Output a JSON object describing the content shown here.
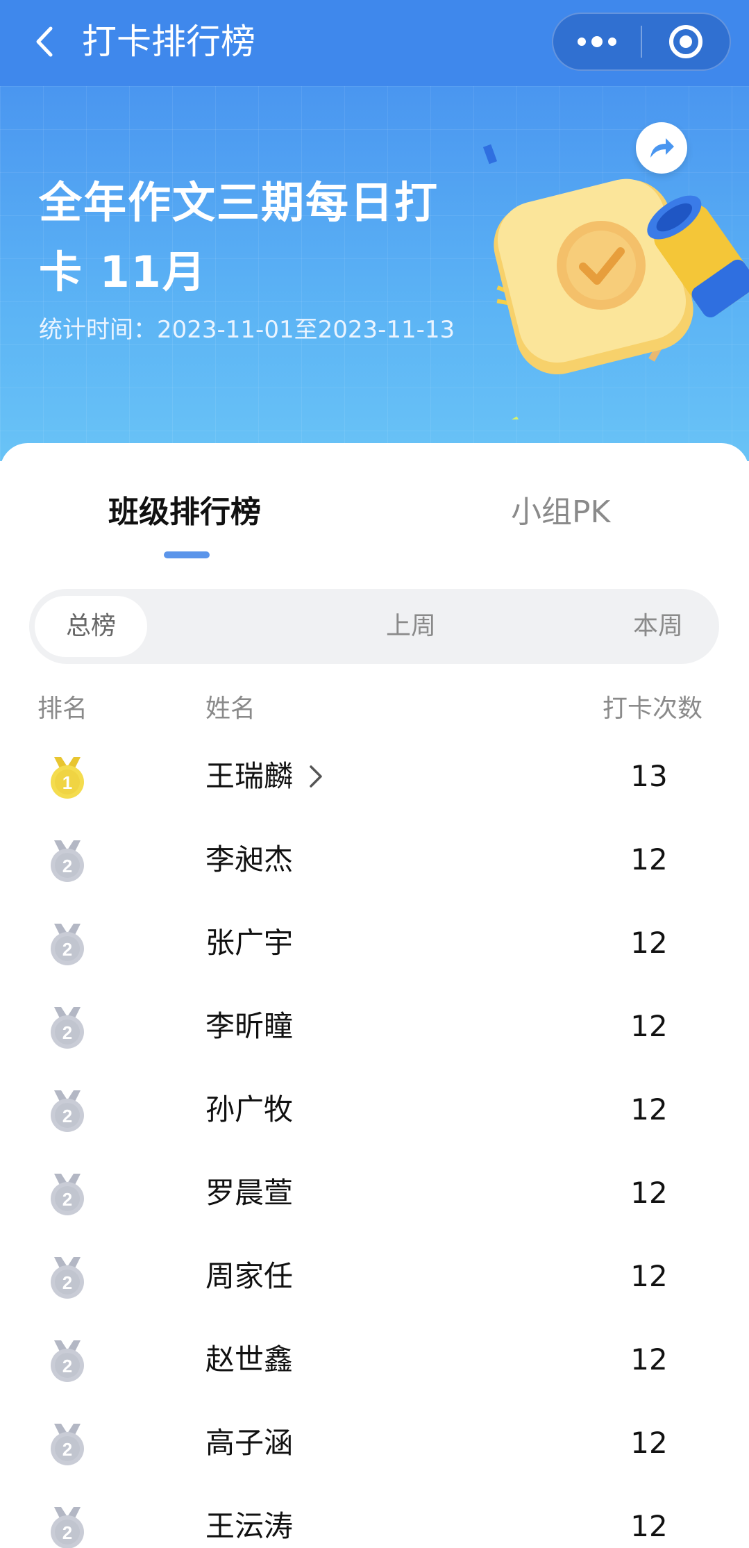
{
  "nav": {
    "title": "打卡排行榜"
  },
  "hero": {
    "title": "全年作文三期每日打卡 11月",
    "period": "统计时间：2023-11-01至2023-11-13"
  },
  "tabs": [
    {
      "label": "班级排行榜",
      "active": true
    },
    {
      "label": "小组PK",
      "active": false
    }
  ],
  "segments": [
    {
      "label": "总榜",
      "selected": true
    },
    {
      "label": "上周",
      "selected": false
    },
    {
      "label": "本周",
      "selected": false
    }
  ],
  "columns": {
    "rank": "排名",
    "name": "姓名",
    "count": "打卡次数"
  },
  "rows": [
    {
      "rank": "1",
      "name": "王瑞麟",
      "count": "13",
      "medal": "gold"
    },
    {
      "rank": "2",
      "name": "李昶杰",
      "count": "12",
      "medal": "silver"
    },
    {
      "rank": "2",
      "name": "张广宇",
      "count": "12",
      "medal": "silver"
    },
    {
      "rank": "2",
      "name": "李昕瞳",
      "count": "12",
      "medal": "silver"
    },
    {
      "rank": "2",
      "name": "孙广牧",
      "count": "12",
      "medal": "silver"
    },
    {
      "rank": "2",
      "name": "罗晨萱",
      "count": "12",
      "medal": "silver"
    },
    {
      "rank": "2",
      "name": "周家任",
      "count": "12",
      "medal": "silver"
    },
    {
      "rank": "2",
      "name": "赵世鑫",
      "count": "12",
      "medal": "silver"
    },
    {
      "rank": "2",
      "name": "高子涵",
      "count": "12",
      "medal": "silver"
    },
    {
      "rank": "2",
      "name": "王沄涛",
      "count": "12",
      "medal": "silver"
    }
  ],
  "colors": {
    "nav_bg": "#3f88ec",
    "tab_indicator": "#5b95ea",
    "gold": "#f3d94a",
    "silver": "#c9ccd6"
  }
}
